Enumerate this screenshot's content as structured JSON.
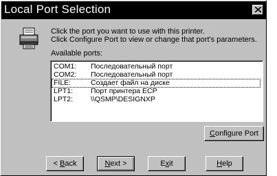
{
  "window": {
    "title": "Local Port Selection",
    "close_icon": "close-icon"
  },
  "instructions": {
    "line1": "Click the port you want to use with this printer.",
    "line2": "Click Configure Port to view or change that port's parameters."
  },
  "ports_label": "Available ports:",
  "ports": [
    {
      "port": "COM1:",
      "description": "Последовательный порт",
      "selected": false
    },
    {
      "port": "COM2:",
      "description": "Последовательный порт",
      "selected": false
    },
    {
      "port": "FILE:",
      "description": "Создает файл на диске",
      "selected": true
    },
    {
      "port": "LPT1:",
      "description": "Порт принтера ECP",
      "selected": false
    },
    {
      "port": "LPT2:",
      "description": "\\\\QSMP\\DESIGNXP",
      "selected": false
    }
  ],
  "buttons": {
    "configure_mnemonic": "C",
    "configure_rest": "onfigure Port",
    "back_prefix": "< ",
    "back_mnemonic": "B",
    "back_rest": "ack",
    "next_mnemonic": "N",
    "next_rest": "ext >",
    "exit_prefix": "E",
    "exit_mnemonic": "x",
    "exit_rest": "it",
    "help_mnemonic": "H",
    "help_rest": "elp"
  }
}
